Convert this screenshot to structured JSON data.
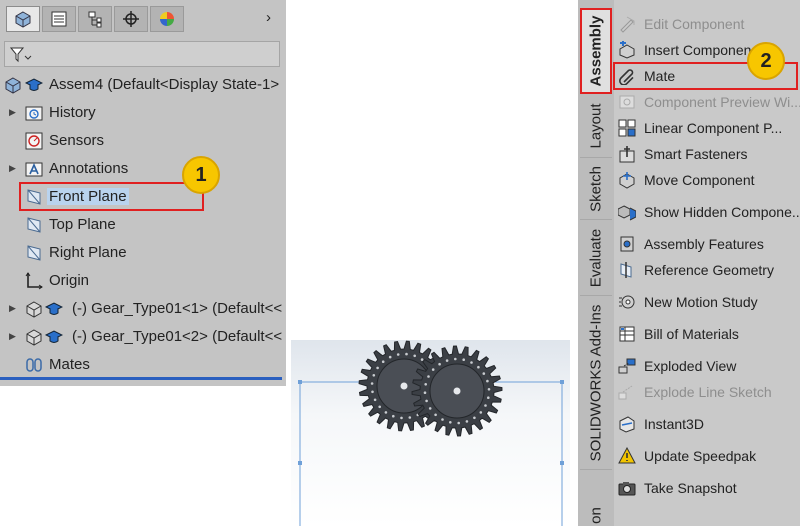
{
  "feature_manager": {
    "tabs": [
      "feature-manager-tab",
      "property-manager-tab",
      "configuration-manager-tab",
      "dim-xpert-tab",
      "display-manager-tab"
    ],
    "tree": {
      "root": "Assem4  (Default<Display State-1>",
      "history": "History",
      "sensors": "Sensors",
      "annotations": "Annotations",
      "front_plane": "Front Plane",
      "top_plane": "Top Plane",
      "right_plane": "Right Plane",
      "origin": "Origin",
      "gear1": "(-) Gear_Type01<1> (Default<<",
      "gear2": "(-) Gear_Type01<2> (Default<<",
      "mates": "Mates"
    }
  },
  "callouts": {
    "first": "1",
    "second": "2"
  },
  "command_manager": {
    "tabs": {
      "assembly": "Assembly",
      "layout": "Layout",
      "sketch": "Sketch",
      "evaluate": "Evaluate",
      "addins": "SOLIDWORKS Add-Ins",
      "last": "on"
    },
    "commands": {
      "edit_component": "Edit Component",
      "insert_components": "Insert Componen",
      "mate": "Mate",
      "component_preview": "Component Preview Wi...",
      "linear_pattern": "Linear Component P...",
      "smart_fasteners": "Smart Fasteners",
      "move_component": "Move Component",
      "show_hidden": "Show Hidden Compone...",
      "assembly_features": "Assembly Features",
      "reference_geometry": "Reference Geometry",
      "new_motion_study": "New Motion Study",
      "bill_of_materials": "Bill of Materials",
      "exploded_view": "Exploded View",
      "explode_line_sketch": "Explode Line Sketch",
      "instant3d": "Instant3D",
      "update_speedpak": "Update Speedpak",
      "take_snapshot": "Take Snapshot"
    }
  },
  "colors": {
    "highlight": "#e02020",
    "badge": "#f7c600",
    "selection": "#b9d3ee"
  }
}
